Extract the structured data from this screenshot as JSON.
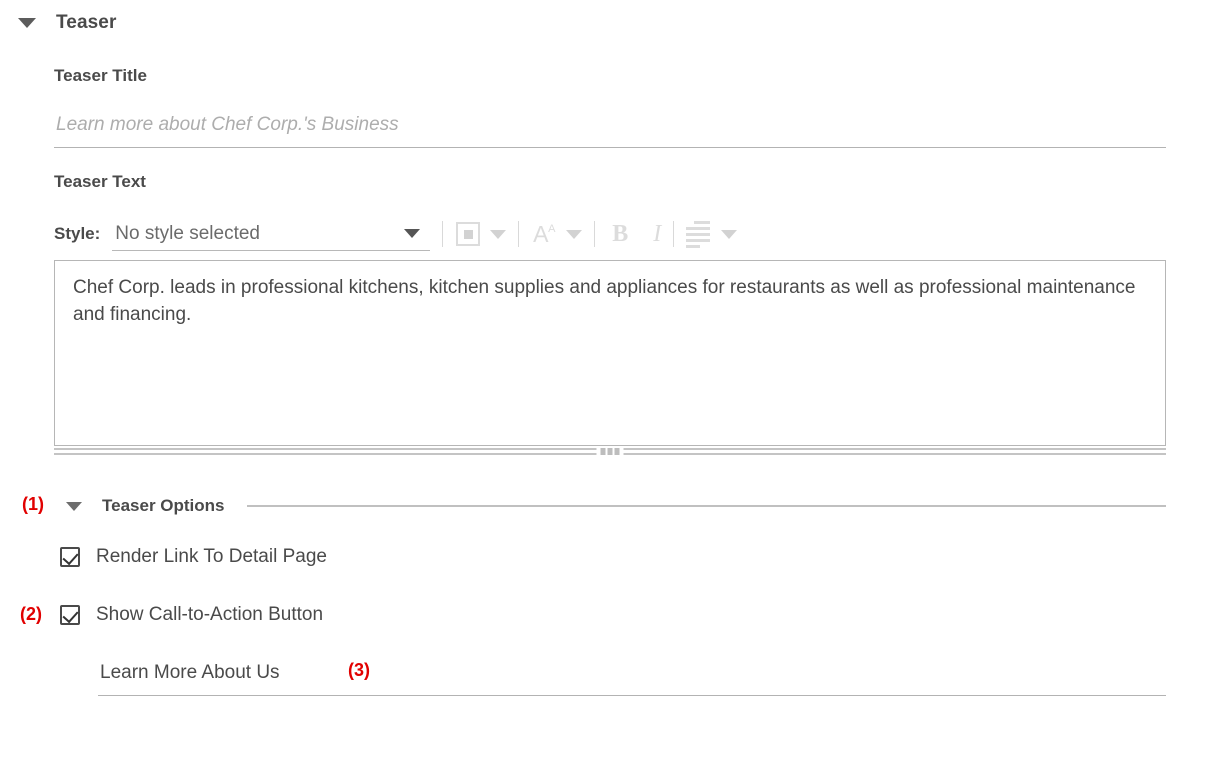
{
  "section": {
    "title": "Teaser",
    "collapse_icon": "triangle-down-icon"
  },
  "teaser_title": {
    "label": "Teaser Title",
    "value": "",
    "placeholder": "Learn more about Chef Corp.'s Business"
  },
  "teaser_text": {
    "label": "Teaser Text",
    "toolbar": {
      "style_label": "Style:",
      "style_value": "No style selected",
      "buttons": [
        {
          "name": "text-color-swatch",
          "label": ""
        },
        {
          "name": "text-color-dropdown",
          "label": ""
        },
        {
          "name": "font-size",
          "label": "A"
        },
        {
          "name": "font-size-dropdown",
          "label": ""
        },
        {
          "name": "bold",
          "label": "B"
        },
        {
          "name": "italic",
          "label": "I"
        },
        {
          "name": "align",
          "label": ""
        },
        {
          "name": "align-dropdown",
          "label": ""
        }
      ]
    },
    "content": "Chef Corp. leads in professional kitchens, kitchen supplies and appliances for restaurants as well as professional maintenance and financing."
  },
  "teaser_options": {
    "title": "Teaser Options",
    "collapse_icon": "triangle-down-icon",
    "annotation": "(1)",
    "checkboxes": [
      {
        "label": "Render Link To Detail Page",
        "checked": true,
        "annotation": ""
      },
      {
        "label": "Show Call-to-Action Button",
        "checked": true,
        "annotation": "(2)"
      }
    ],
    "cta_field": {
      "value": "Learn More About Us",
      "placeholder": "",
      "annotation": "(3)"
    }
  },
  "colors": {
    "annotation_red": "#e10000",
    "text_dark": "#4a4a4a",
    "placeholder_gray": "#adadad",
    "rule_gray": "#c0c0c0",
    "disabled_icon": "#dcdcdc"
  }
}
